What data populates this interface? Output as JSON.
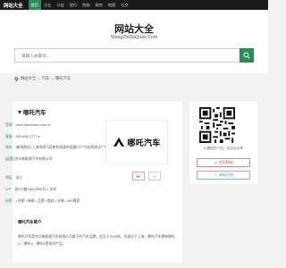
{
  "topbar": {
    "logo": "网站大全",
    "nav": [
      "首页",
      "企业",
      "公益",
      "银行",
      "购物",
      "政府",
      "地图",
      "社交"
    ]
  },
  "hero": {
    "title": "网站大全",
    "subtitle": "WangZhiDaQuan.Com",
    "search_placeholder": "请输入关键词..."
  },
  "breadcrumb": [
    "网站大全",
    "汽车",
    "哪吒汽车"
  ],
  "site": {
    "name": "哪吒汽车",
    "website_label": "官网",
    "website": "www.hozonauto.com",
    "phone_label": "客服",
    "phone": "400-608-7777",
    "address_label": "地址",
    "address": "[新闻地址] 上海市闵行区新虹街道申昆路2377号虹桥商业广场F座",
    "company": "[运营] 合众新能源汽车有限公司",
    "region_label": "地区",
    "region": "浙江",
    "icp_label": "ICP",
    "icp": "浙ICP备16012550号-1",
    "icp_tag": "查询",
    "tags_label": "标签",
    "tags": "• 合肥 • 新能 • 品牌 • 酷炫 • 未来 • 360搜索"
  },
  "brand_logo_text": "哪吒汽车",
  "like_count": "5",
  "sidebar": {
    "qr_caption": "微信扫一扫，关注公众号",
    "visit_button": "访问网站",
    "intro_button": "网站介绍"
  },
  "intro": {
    "title": "哪吒汽车简介",
    "text": "哪吒汽车是合众新能源汽车有限公司旗下的汽车品牌。创立于2018年，总部位于上海。哪吒汽车拥有哪吒U、哪吒V、哪吒S等系列产品。"
  },
  "colors": {
    "accent": "#2e8b57",
    "topbar": "#1a1a1a",
    "link_red": "#dd3333",
    "link_blue": "#3a7bd5"
  }
}
